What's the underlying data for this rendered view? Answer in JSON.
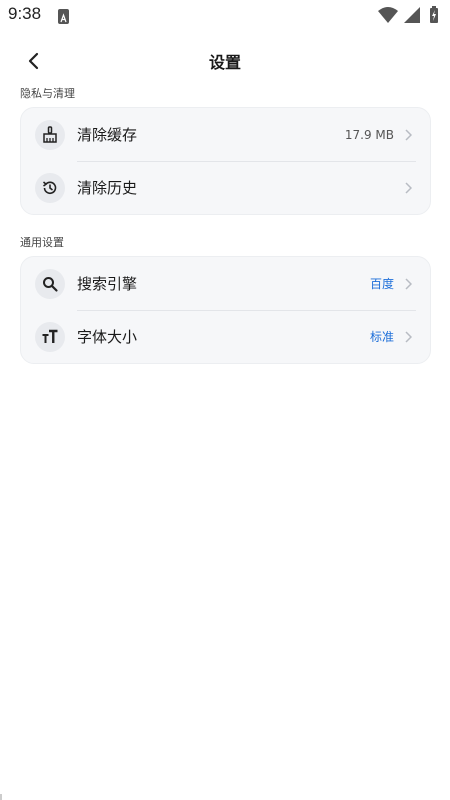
{
  "status_bar": {
    "time": "9:38",
    "icons": [
      "app-notification-icon",
      "wifi-icon",
      "signal-icon",
      "battery-charging-icon"
    ]
  },
  "header": {
    "title": "设置",
    "back_icon": "chevron-left-icon"
  },
  "sections": [
    {
      "title": "隐私与清理",
      "items": [
        {
          "label": "清除缓存",
          "value": "17.9 MB",
          "icon": "broom-icon"
        },
        {
          "label": "清除历史",
          "value": "",
          "icon": "history-icon"
        }
      ]
    },
    {
      "title": "通用设置",
      "items": [
        {
          "label": "搜索引擎",
          "value": "百度",
          "icon": "search-icon"
        },
        {
          "label": "字体大小",
          "value": "标准",
          "icon": "text-size-icon"
        }
      ]
    }
  ],
  "colors": {
    "accent": "#1e6fd9",
    "card_background": "#f6f7f9",
    "icon_background": "#e8eaee"
  }
}
